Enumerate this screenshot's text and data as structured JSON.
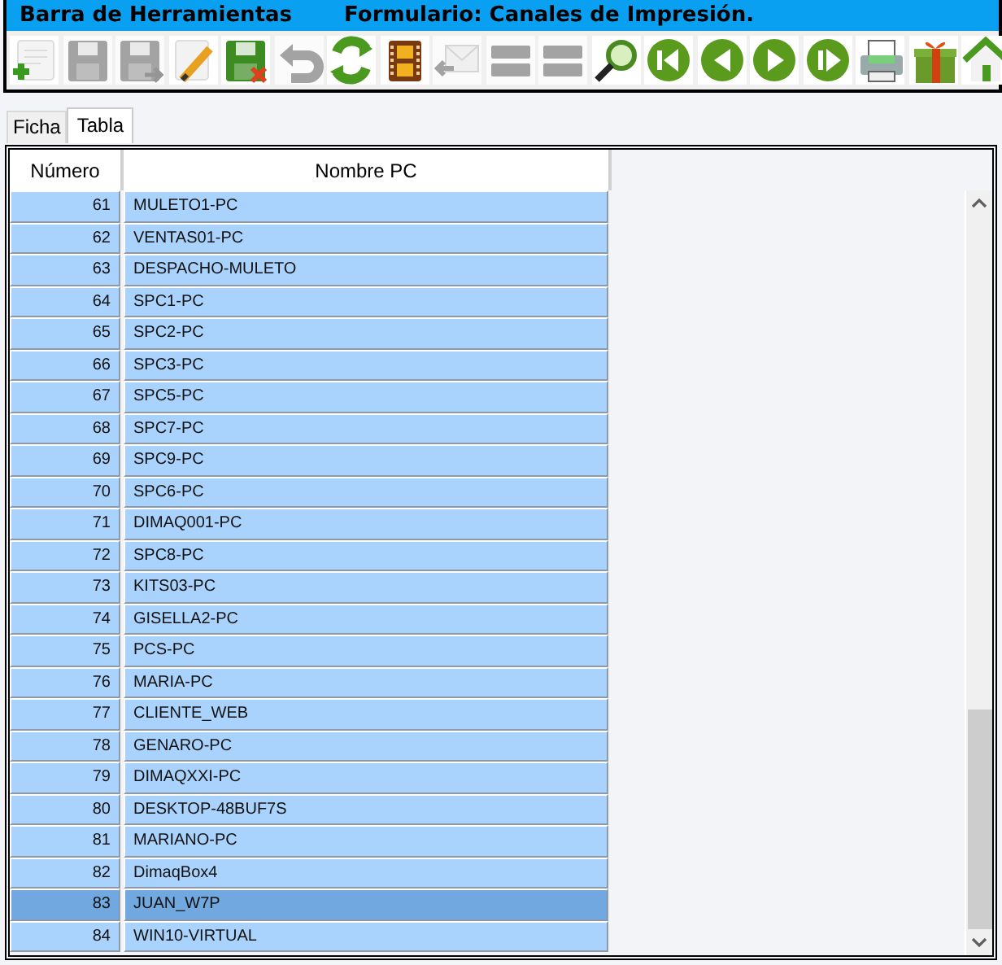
{
  "title_bar": {
    "toolbar_name": "Barra de Herramientas",
    "form_name": "Formulario: Canales de Impresión."
  },
  "toolbar": [
    {
      "kind": "new",
      "disabled": false
    },
    {
      "kind": "save",
      "disabled": true
    },
    {
      "kind": "save_as",
      "disabled": true
    },
    {
      "kind": "edit",
      "disabled": false
    },
    {
      "kind": "delete",
      "disabled": false
    },
    {
      "kind": "undo",
      "disabled": true
    },
    {
      "kind": "refresh",
      "disabled": false
    },
    {
      "kind": "film",
      "disabled": false
    },
    {
      "kind": "mail",
      "disabled": true
    },
    {
      "kind": "list",
      "disabled": true
    },
    {
      "kind": "list",
      "disabled": true
    },
    {
      "kind": "search",
      "disabled": false
    },
    {
      "kind": "first",
      "disabled": false
    },
    {
      "kind": "prev",
      "disabled": false
    },
    {
      "kind": "next",
      "disabled": false
    },
    {
      "kind": "last",
      "disabled": false
    },
    {
      "kind": "print",
      "disabled": false
    },
    {
      "kind": "gift",
      "disabled": false
    },
    {
      "kind": "home",
      "disabled": false
    }
  ],
  "tabs": [
    {
      "label": "Ficha",
      "selected": false
    },
    {
      "label": "Tabla",
      "selected": true
    }
  ],
  "table": {
    "columns": [
      "Número",
      "Nombre PC"
    ],
    "rows": [
      {
        "numero": "61",
        "nombre": "MULETO1-PC",
        "selected": false
      },
      {
        "numero": "62",
        "nombre": "VENTAS01-PC",
        "selected": false
      },
      {
        "numero": "63",
        "nombre": "DESPACHO-MULETO",
        "selected": false
      },
      {
        "numero": "64",
        "nombre": "SPC1-PC",
        "selected": false
      },
      {
        "numero": "65",
        "nombre": "SPC2-PC",
        "selected": false
      },
      {
        "numero": "66",
        "nombre": "SPC3-PC",
        "selected": false
      },
      {
        "numero": "67",
        "nombre": "SPC5-PC",
        "selected": false
      },
      {
        "numero": "68",
        "nombre": "SPC7-PC",
        "selected": false
      },
      {
        "numero": "69",
        "nombre": "SPC9-PC",
        "selected": false
      },
      {
        "numero": "70",
        "nombre": "SPC6-PC",
        "selected": false
      },
      {
        "numero": "71",
        "nombre": "DIMAQ001-PC",
        "selected": false
      },
      {
        "numero": "72",
        "nombre": "SPC8-PC",
        "selected": false
      },
      {
        "numero": "73",
        "nombre": "KITS03-PC",
        "selected": false
      },
      {
        "numero": "74",
        "nombre": "GISELLA2-PC",
        "selected": false
      },
      {
        "numero": "75",
        "nombre": "PCS-PC",
        "selected": false
      },
      {
        "numero": "76",
        "nombre": "MARIA-PC",
        "selected": false
      },
      {
        "numero": "77",
        "nombre": "CLIENTE_WEB",
        "selected": false
      },
      {
        "numero": "78",
        "nombre": "GENARO-PC",
        "selected": false
      },
      {
        "numero": "79",
        "nombre": "DIMAQXXI-PC",
        "selected": false
      },
      {
        "numero": "80",
        "nombre": "DESKTOP-48BUF7S",
        "selected": false
      },
      {
        "numero": "81",
        "nombre": "MARIANO-PC",
        "selected": false
      },
      {
        "numero": "82",
        "nombre": "DimaqBox4",
        "selected": false
      },
      {
        "numero": "83",
        "nombre": "JUAN_W7P",
        "selected": true
      },
      {
        "numero": "84",
        "nombre": "WIN10-VIRTUAL",
        "selected": false
      }
    ]
  }
}
